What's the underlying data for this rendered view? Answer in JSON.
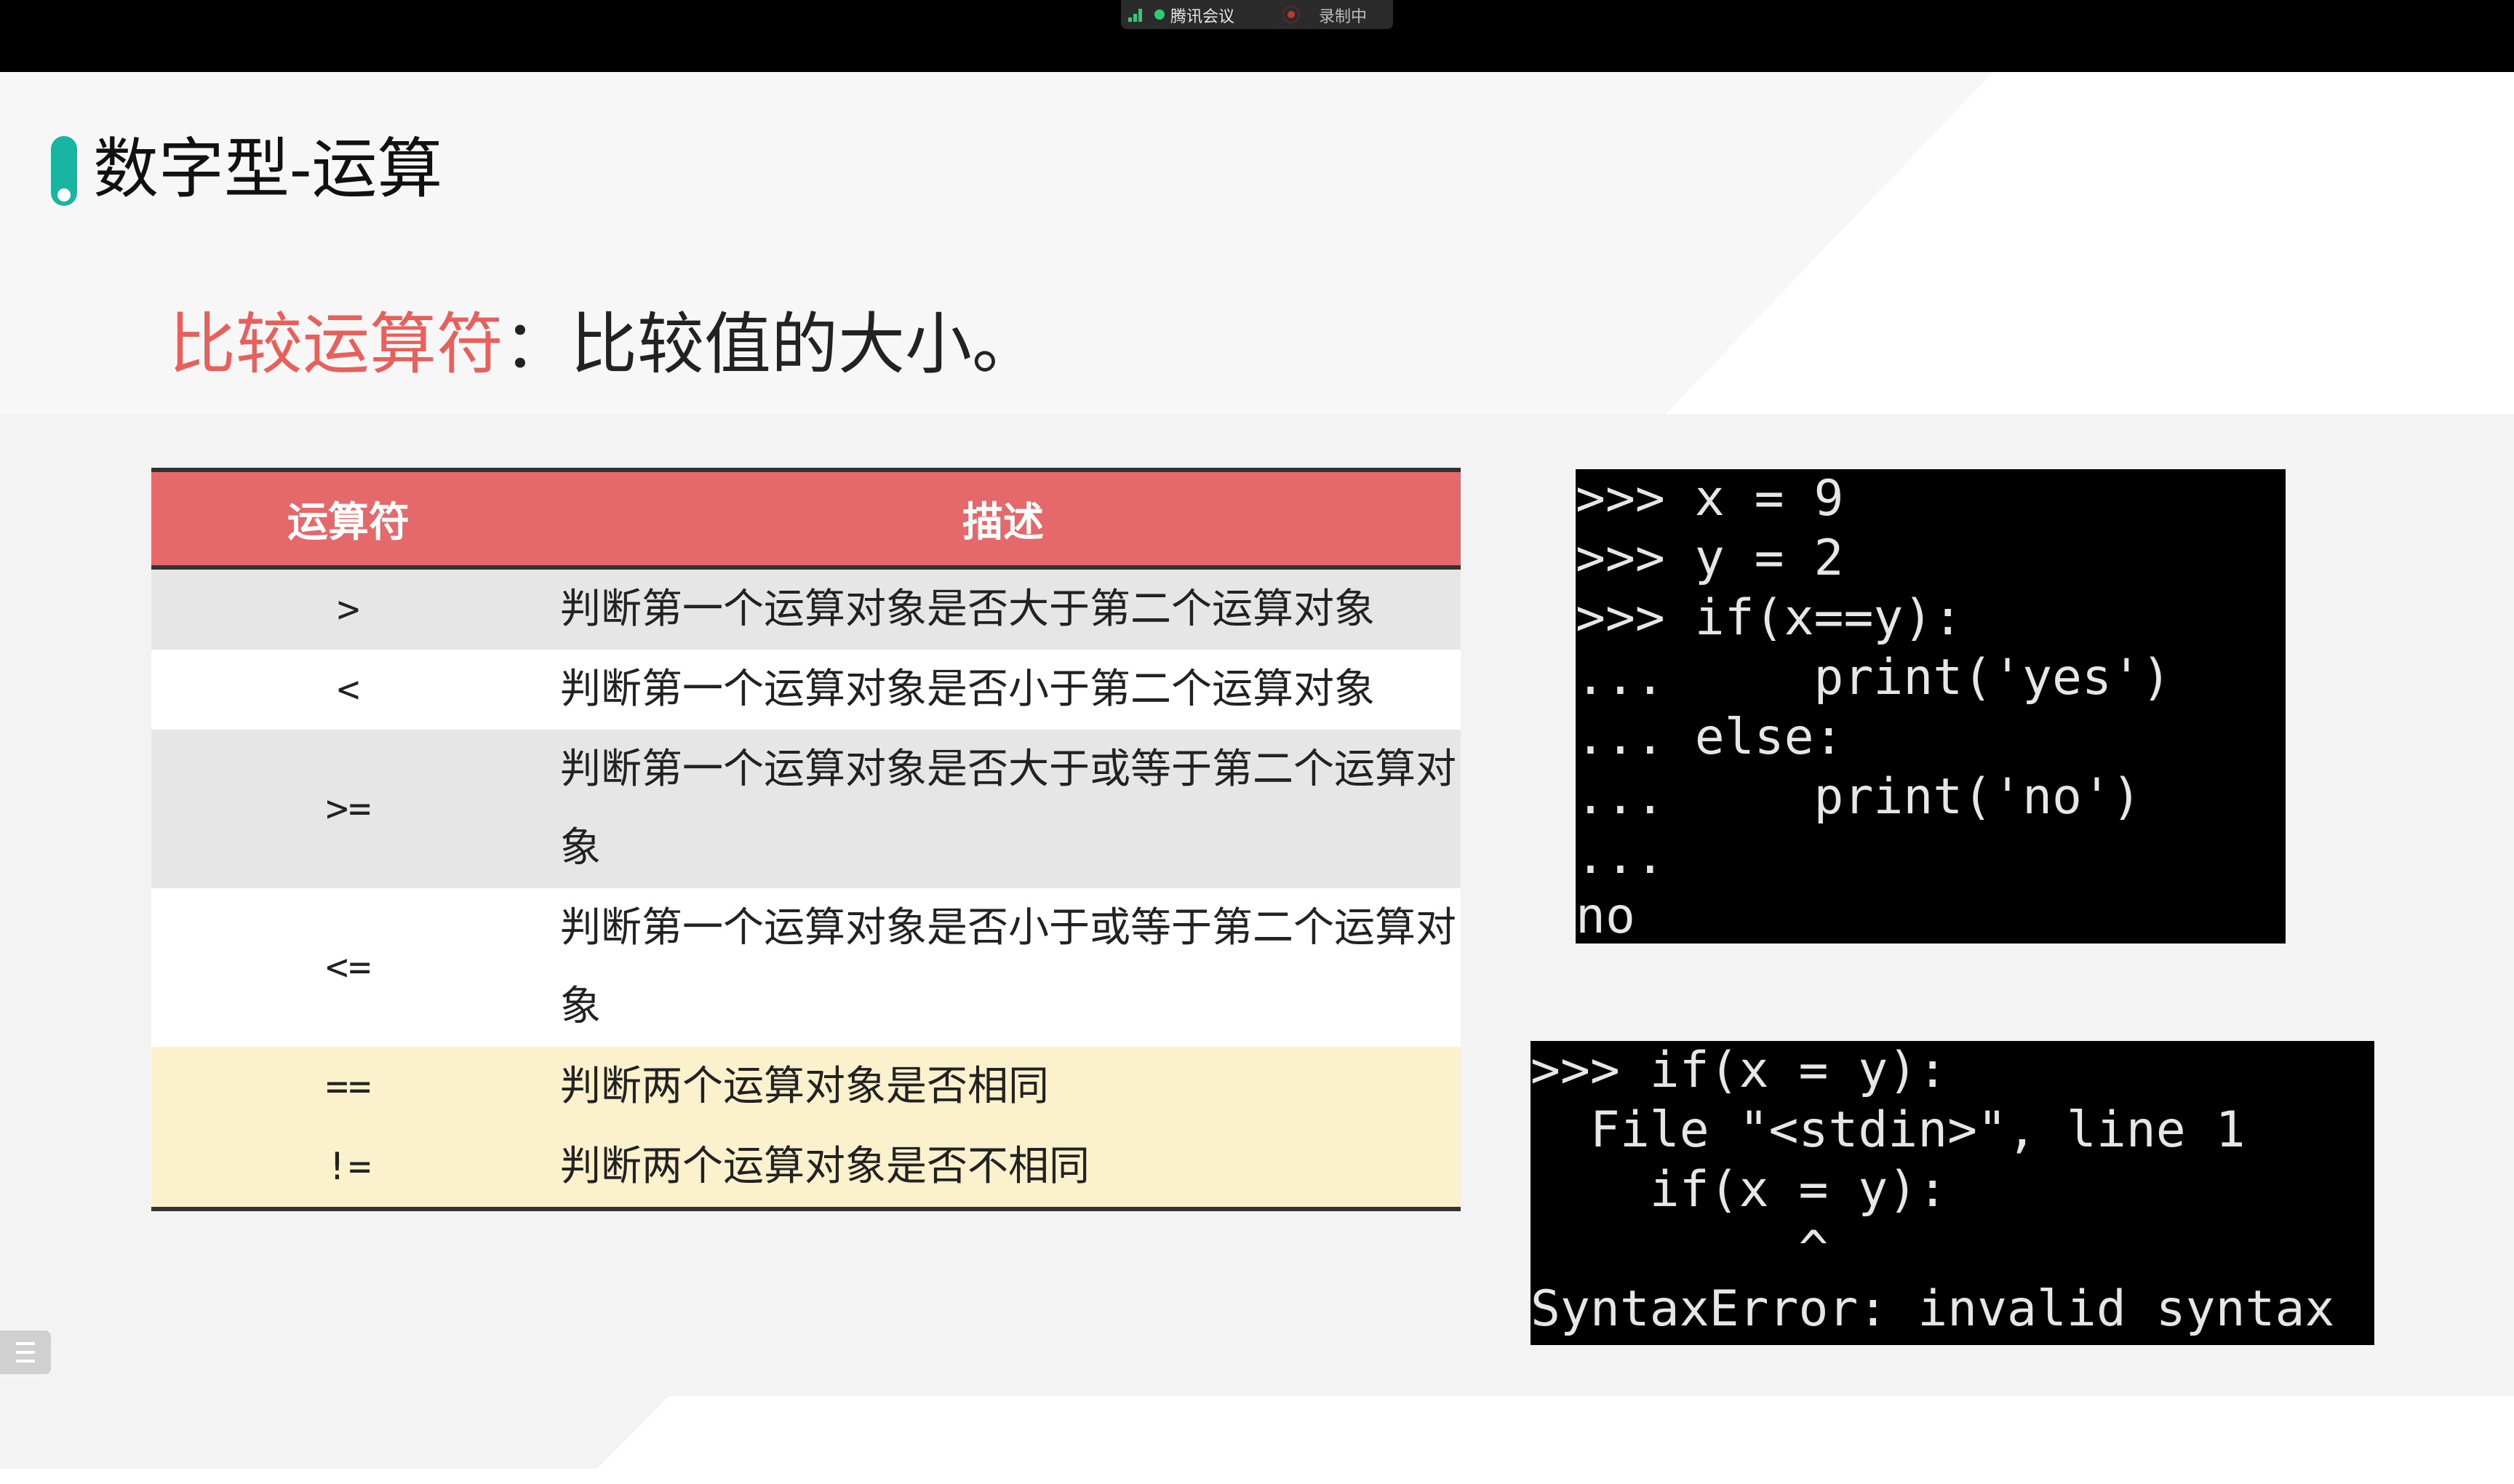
{
  "meeting_bar": {
    "app_name": "腾讯会议",
    "recording_label": "录制中"
  },
  "slide": {
    "title": "数字型-运算",
    "subtitle_key": "比较运算符",
    "subtitle_rest": "：比较值的大小。",
    "table": {
      "headers": [
        "运算符",
        "描述"
      ],
      "rows": [
        {
          "op": ">",
          "desc": "判断第一个运算对象是否大于第二个运算对象"
        },
        {
          "op": "<",
          "desc": "判断第一个运算对象是否小于第二个运算对象"
        },
        {
          "op": ">=",
          "desc": "判断第一个运算对象是否大于或等于第二个运算对象"
        },
        {
          "op": "<=",
          "desc": "判断第一个运算对象是否小于或等于第二个运算对象"
        },
        {
          "op": "==",
          "desc": "判断两个运算对象是否相同"
        },
        {
          "op": "!=",
          "desc": "判断两个运算对象是否不相同"
        }
      ]
    },
    "terminal_1": ">>> x = 9\n>>> y = 2\n>>> if(x==y):\n...     print('yes')\n... else:\n...     print('no')\n...\nno",
    "terminal_2": ">>> if(x = y):\n  File \"<stdin>\", line 1\n    if(x = y):\n         ^\nSyntaxError: invalid syntax"
  },
  "colors": {
    "accent_teal": "#19b5a3",
    "header_red": "#e5696a",
    "subtitle_red": "#e8605c",
    "row_yellow": "#fbf1cc"
  }
}
